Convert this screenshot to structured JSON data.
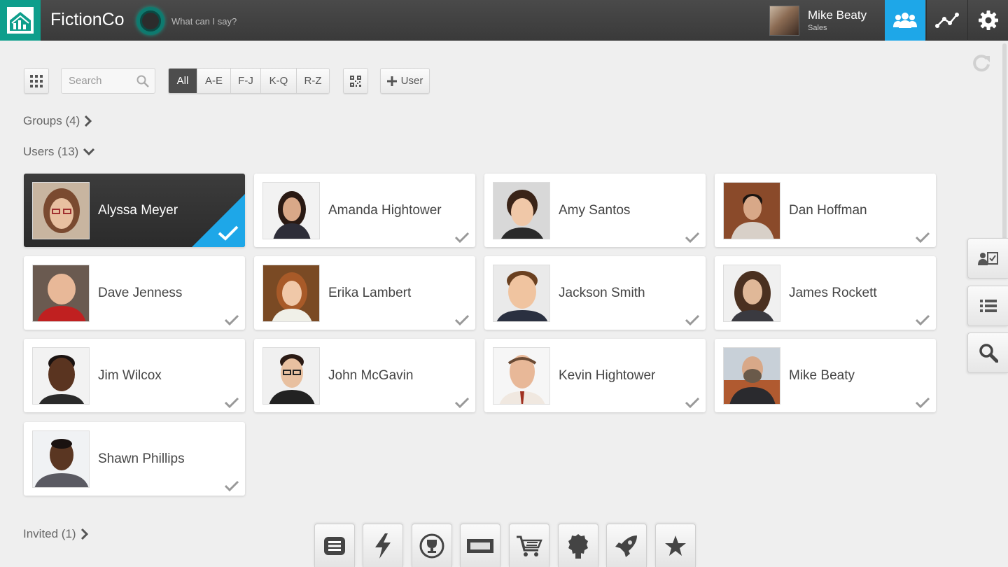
{
  "app": {
    "brand": "FictionCo",
    "assistant_prompt": "What can I say?"
  },
  "current_user": {
    "name": "Mike Beaty",
    "role": "Sales"
  },
  "toolbar": {
    "search_placeholder": "Search",
    "filters": [
      "All",
      "A-E",
      "F-J",
      "K-Q",
      "R-Z"
    ],
    "active_filter": "All",
    "add_user_label": "User"
  },
  "sections": {
    "groups": "Groups (4)",
    "users": "Users (13)",
    "invited": "Invited (1)"
  },
  "users": [
    {
      "name": "Alyssa Meyer",
      "selected": true
    },
    {
      "name": "Amanda Hightower",
      "selected": false
    },
    {
      "name": "Amy Santos",
      "selected": false
    },
    {
      "name": "Dan Hoffman",
      "selected": false
    },
    {
      "name": "Dave Jenness",
      "selected": false
    },
    {
      "name": "Erika Lambert",
      "selected": false
    },
    {
      "name": "Jackson Smith",
      "selected": false
    },
    {
      "name": "James Rockett",
      "selected": false
    },
    {
      "name": "Jim Wilcox",
      "selected": false
    },
    {
      "name": "John McGavin",
      "selected": false
    },
    {
      "name": "Kevin Hightower",
      "selected": false
    },
    {
      "name": "Mike Beaty",
      "selected": false
    },
    {
      "name": "Shawn Phillips",
      "selected": false
    }
  ],
  "colors": {
    "accent": "#1ea7e8",
    "logo": "#0e9e8c",
    "topbar": "#404040"
  },
  "icons": {
    "top": [
      "users-icon",
      "network-icon",
      "gear-icon"
    ],
    "side": [
      "assign-icon",
      "list-icon",
      "search-icon"
    ],
    "dock": [
      "menu-icon",
      "lightning-icon",
      "trophy-icon",
      "card-icon",
      "cart-icon",
      "badge-icon",
      "rocket-icon",
      "star-icon"
    ]
  }
}
